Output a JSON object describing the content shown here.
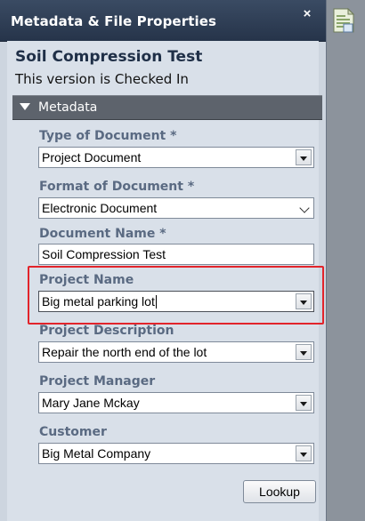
{
  "window": {
    "title": "Metadata & File Properties",
    "close_glyph": "×"
  },
  "document": {
    "title": "Soil Compression Test",
    "status": "This version is Checked In"
  },
  "section": {
    "label": "Metadata"
  },
  "fields": {
    "type_of_document": {
      "label": "Type of Document *",
      "value": "Project Document"
    },
    "format_of_document": {
      "label": "Format of Document *",
      "value": "Electronic Document"
    },
    "document_name": {
      "label": "Document Name *",
      "value": "Soil Compression Test"
    },
    "project_name": {
      "label": "Project Name",
      "value": "Big metal parking lot"
    },
    "project_description": {
      "label": "Project Description",
      "value": "Repair the north end of the lot"
    },
    "project_manager": {
      "label": "Project Manager",
      "value": "Mary Jane Mckay"
    },
    "customer": {
      "label": "Customer",
      "value": "Big Metal Company"
    }
  },
  "buttons": {
    "lookup_label": "Lookup"
  },
  "colors": {
    "title_bar": "#2f3e55",
    "panel_bg": "#d9e0e9",
    "section_header": "#5d636c",
    "label_text": "#5a6a82",
    "highlight": "#e2242b"
  },
  "icons": {
    "close": "close-icon",
    "document": "document-icon",
    "section_toggle": "triangle-down-icon",
    "dropdown": "dropdown-arrow-icon",
    "chevron": "chevron-down-icon"
  }
}
